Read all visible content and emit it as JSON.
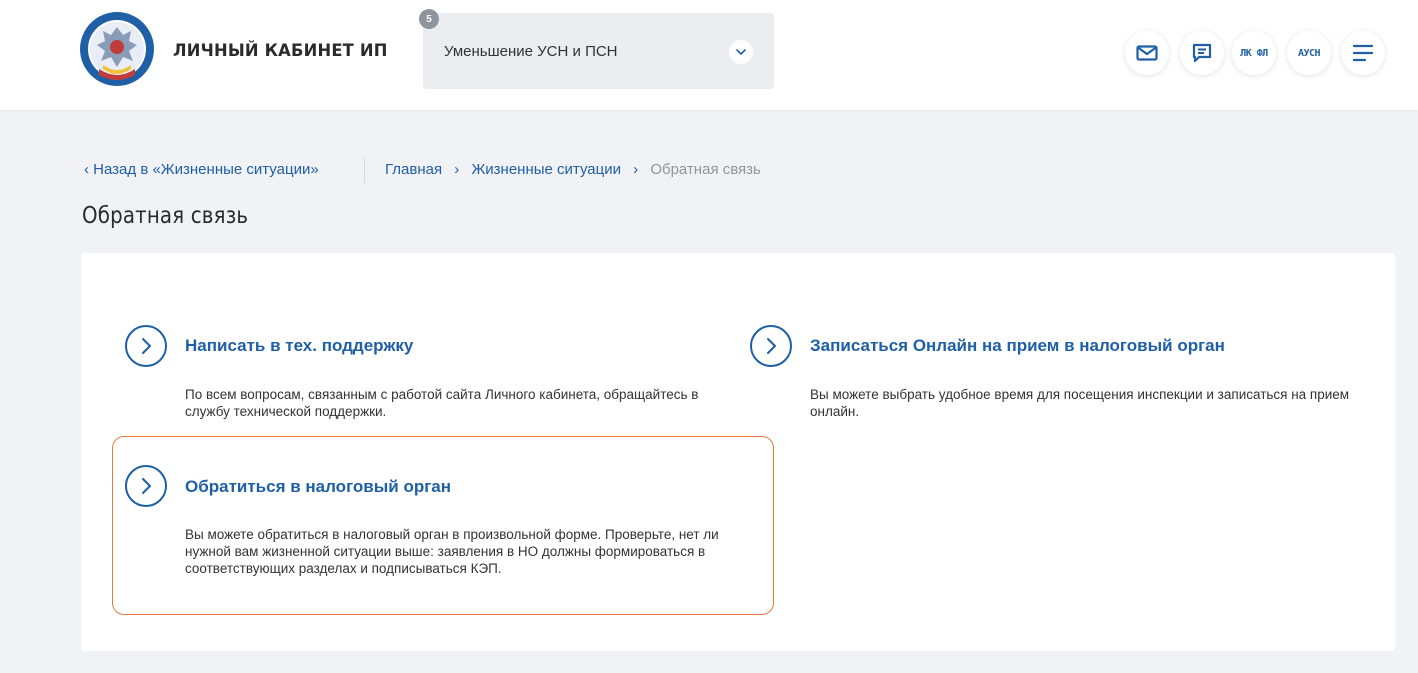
{
  "header": {
    "brand": "ЛИЧНЫЙ КАБИНЕТ ИП",
    "select": {
      "value": "Уменьшение УСН и ПСН",
      "badge": "5"
    },
    "buttons": {
      "mail_icon": "envelope-icon",
      "chat_icon": "chat-icon",
      "lk_fl": "ЛК ФЛ",
      "ausn": "АУСН",
      "menu_icon": "hamburger-icon"
    }
  },
  "breadcrumbs": {
    "back": "Назад в «Жизненные ситуации»",
    "items": [
      "Главная",
      "Жизненные ситуации",
      "Обратная связь"
    ]
  },
  "page": {
    "title": "Обратная связь"
  },
  "items": [
    {
      "title": "Написать в тех. поддержку",
      "desc": "По всем вопросам, связанным с работой сайта Личного кабинета, обращайтесь в службу технической поддержки."
    },
    {
      "title": "Записаться Онлайн на прием в налоговый орган",
      "desc": "Вы можете выбрать удобное время для посещения инспекции и записаться на прием онлайн."
    },
    {
      "title": "Обратиться в налоговый орган",
      "desc": "Вы можете обратиться в налоговый орган в произвольной форме. Проверьте, нет ли нужной вам жизненной ситуации выше: заявления в НО должны формироваться в соответствующих разделах и подписываться КЭП."
    }
  ],
  "colors": {
    "accent": "#1f5fa6",
    "highlight": "#e67a3c",
    "background": "#f0f2f5"
  }
}
